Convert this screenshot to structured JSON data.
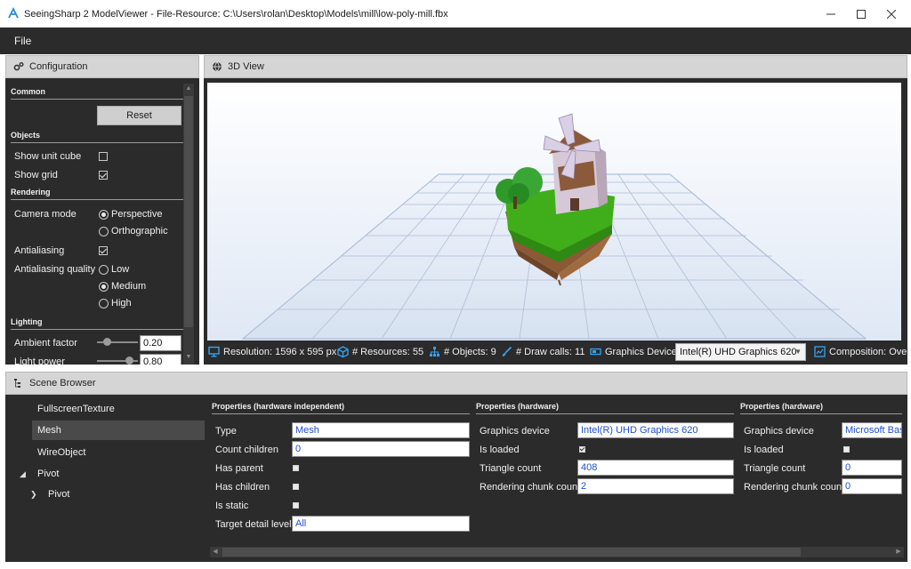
{
  "window": {
    "title": "SeeingSharp 2 ModelViewer - File-Resource: C:\\Users\\rolan\\Desktop\\Models\\mill\\low-poly-mill.fbx"
  },
  "menu": {
    "file": "File"
  },
  "configuration": {
    "header": "Configuration",
    "common_section": "Common",
    "reset_label": "Reset",
    "objects_section": "Objects",
    "show_unit_cube": {
      "label": "Show unit cube",
      "checked": false
    },
    "show_grid": {
      "label": "Show grid",
      "checked": true
    },
    "rendering_section": "Rendering",
    "camera_mode": {
      "label": "Camera mode",
      "options": [
        "Perspective",
        "Orthographic"
      ],
      "selected": "Perspective"
    },
    "antialiasing": {
      "label": "Antialiasing",
      "checked": true
    },
    "antialiasing_quality": {
      "label": "Antialiasing quality",
      "options": [
        "Low",
        "Medium",
        "High"
      ],
      "selected": "Medium"
    },
    "lighting_section": "Lighting",
    "ambient_factor": {
      "label": "Ambient factor",
      "value": "0.20",
      "level": 0.2
    },
    "light_power": {
      "label": "Light power",
      "value": "0.80",
      "level": 0.8
    }
  },
  "view3d": {
    "header": "3D View",
    "status": {
      "resolution": "Resolution: 1596 x 595 px",
      "resources": "# Resources: 55",
      "objects": "# Objects: 9",
      "draw_calls": "# Draw calls: 11",
      "graphics_device_label": "Graphics Device:",
      "graphics_device_value": "Intel(R) UHD Graphics 620",
      "composition": "Composition: Ove"
    }
  },
  "scene_browser": {
    "header": "Scene Browser",
    "items": [
      "FullscreenTexture",
      "Mesh",
      "WireObject",
      "Pivot",
      "Pivot"
    ],
    "selected": "Mesh"
  },
  "properties": {
    "independent": {
      "header": "Properties (hardware independent)",
      "type_label": "Type",
      "type_value": "Mesh",
      "count_children_label": "Count children",
      "count_children_value": "0",
      "has_parent_label": "Has parent",
      "has_parent_checked": false,
      "has_children_label": "Has children",
      "has_children_checked": false,
      "is_static_label": "Is static",
      "is_static_checked": false,
      "target_detail_label": "Target detail level",
      "target_detail_value": "All"
    },
    "hardware1": {
      "header": "Properties (hardware)",
      "device_label": "Graphics device",
      "device_value": "Intel(R) UHD Graphics 620",
      "loaded_label": "Is loaded",
      "loaded_checked": true,
      "triangle_label": "Triangle count",
      "triangle_value": "408",
      "chunk_label": "Rendering chunk count",
      "chunk_value": "2"
    },
    "hardware2": {
      "header": "Properties (hardware)",
      "device_label": "Graphics device",
      "device_value": "Microsoft Bas",
      "loaded_label": "Is loaded",
      "loaded_checked": false,
      "triangle_label": "Triangle count",
      "triangle_value": "0",
      "chunk_label": "Rendering chunk count",
      "chunk_value": "0"
    }
  },
  "colors": {
    "panel_bg": "#2b2b2b",
    "header_bg": "#d5d5d5",
    "value_text": "#1d4fd1"
  }
}
